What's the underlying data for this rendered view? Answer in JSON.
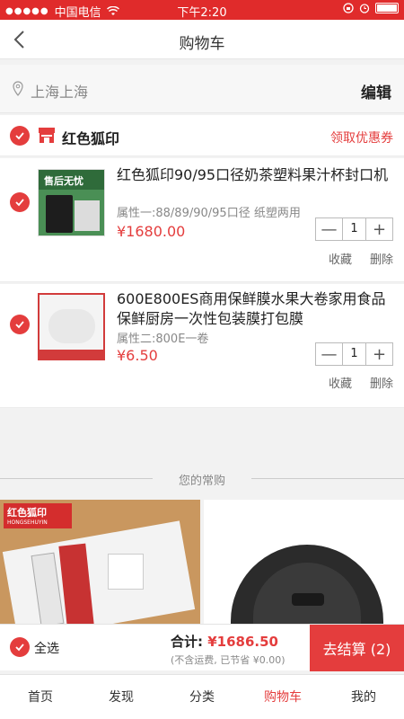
{
  "status": {
    "carrier": "中国电信",
    "time": "下午2:20"
  },
  "nav": {
    "title": "购物车"
  },
  "address": {
    "text": "上海上海",
    "edit": "编辑"
  },
  "shop": {
    "name": "红色狐印",
    "coupon": "领取优惠券"
  },
  "items": [
    {
      "title": "红色狐印90/95口径奶茶塑料果汁杯封口机",
      "attr": "属性一:88/89/90/95口径 纸塑两用",
      "price": "¥1680.00",
      "qty": "1",
      "fav": "收藏",
      "del": "删除",
      "thumb_text": "售后无忧"
    },
    {
      "title": "600E800ES商用保鲜膜水果大卷家用食品保鲜厨房一次性包装膜打包膜",
      "attr": "属性二:800E一卷",
      "price": "¥6.50",
      "qty": "1",
      "fav": "收藏",
      "del": "删除"
    }
  ],
  "recommend": {
    "label": "您的常购",
    "brand": "红色狐印",
    "brand_sub": "HONGSEHUYIN"
  },
  "footer": {
    "select_all": "全选",
    "total_label": "合计:",
    "total": "¥1686.50",
    "note": "(不含运费, 已节省 ¥0.00)",
    "checkout": "去结算 (2)"
  },
  "tabs": [
    "首页",
    "发现",
    "分类",
    "购物车",
    "我的"
  ],
  "colors": {
    "accent": "#e43d3d"
  }
}
